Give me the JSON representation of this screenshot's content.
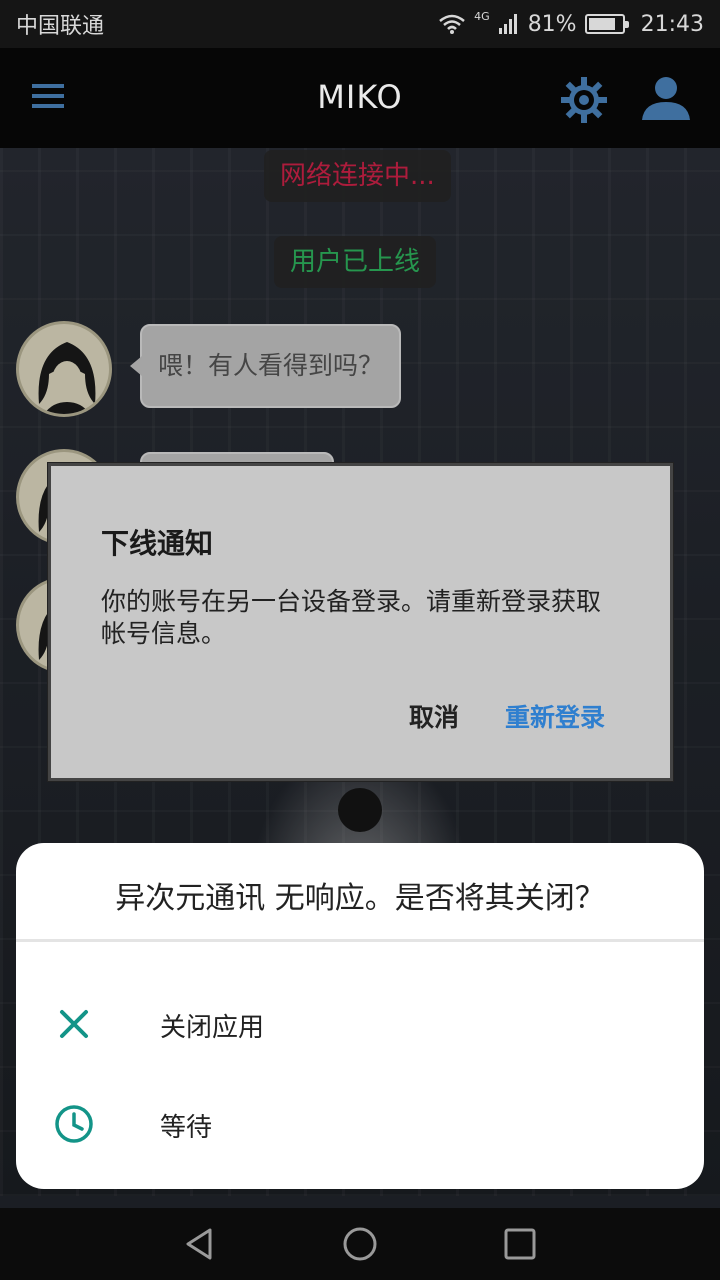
{
  "status_bar": {
    "carrier": "中国联通",
    "network": "4G",
    "battery_percent": "81%",
    "battery_level": 0.81,
    "time": "21:43"
  },
  "app_bar": {
    "title": "MIKO",
    "icons": [
      "menu-icon",
      "gear-icon",
      "user-icon"
    ],
    "accent_color": "#3f6f9f"
  },
  "chat": {
    "system_messages": [
      {
        "text": "网络连接中...",
        "color": "#d4234a"
      },
      {
        "text": "用户已上线",
        "color": "#2fb860"
      }
    ],
    "messages": [
      {
        "text": "喂！有人看得到吗？"
      }
    ]
  },
  "dialog": {
    "title": "下线通知",
    "message": "你的账号在另一台设备登录。请重新登录获取帐号信息。",
    "cancel_label": "取消",
    "relogin_label": "重新登录",
    "relogin_color": "#2f7fcf"
  },
  "anr_sheet": {
    "title": "异次元通讯 无响应。是否将其关闭？",
    "options": [
      {
        "label": "关闭应用",
        "icon": "close-icon",
        "icon_color": "#139488"
      },
      {
        "label": "等待",
        "icon": "clock-icon",
        "icon_color": "#139488"
      }
    ]
  },
  "nav_bar": {
    "icons": [
      "back-icon",
      "home-icon",
      "recents-icon"
    ]
  }
}
